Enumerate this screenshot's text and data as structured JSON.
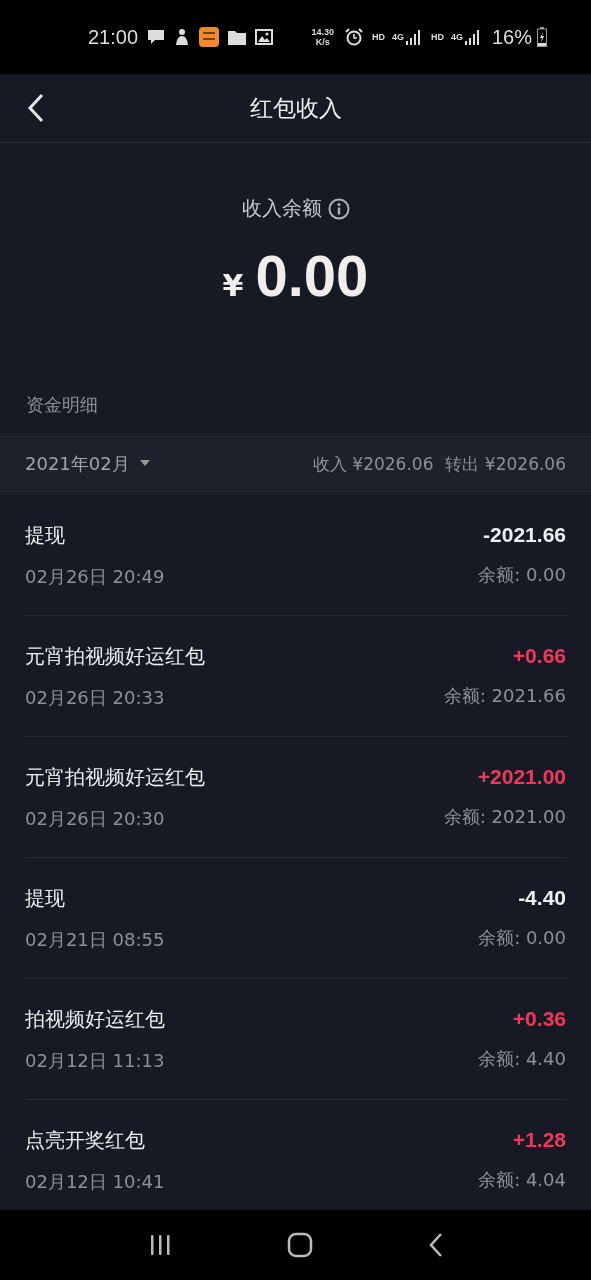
{
  "status_bar": {
    "time": "21:00",
    "speed_value": "14.30",
    "speed_unit": "K/s",
    "network_labels": [
      "HD",
      "4G",
      "HD",
      "4G"
    ],
    "battery": "16%"
  },
  "header": {
    "title": "红包收入"
  },
  "balance": {
    "label": "收入余额",
    "currency": "¥",
    "amount": "0.00"
  },
  "section_title": "资金明细",
  "filter": {
    "month": "2021年02月",
    "income": "收入 ¥2026.06",
    "outgoing": "转出 ¥2026.06"
  },
  "transactions": [
    {
      "title": "提现",
      "time": "02月26日 20:49",
      "amount": "-2021.66",
      "balance": "余额: 0.00",
      "kind": "withdrawal"
    },
    {
      "title": "元宵拍视频好运红包",
      "time": "02月26日 20:33",
      "amount": "+0.66",
      "balance": "余额: 2021.66",
      "kind": "income"
    },
    {
      "title": "元宵拍视频好运红包",
      "time": "02月26日 20:30",
      "amount": "+2021.00",
      "balance": "余额: 2021.00",
      "kind": "income"
    },
    {
      "title": "提现",
      "time": "02月21日 08:55",
      "amount": "-4.40",
      "balance": "余额: 0.00",
      "kind": "withdrawal"
    },
    {
      "title": "拍视频好运红包",
      "time": "02月12日 11:13",
      "amount": "+0.36",
      "balance": "余额: 4.40",
      "kind": "income"
    },
    {
      "title": "点亮开奖红包",
      "time": "02月12日 10:41",
      "amount": "+1.28",
      "balance": "余额: 4.04",
      "kind": "income"
    }
  ]
}
